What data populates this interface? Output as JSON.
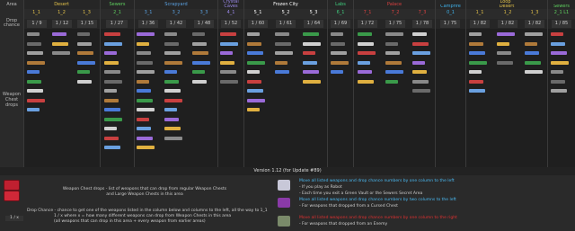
{
  "colors": {
    "desert": "#e3c24a",
    "sewers": "#5fd05f",
    "scrapyard": "#5aa0e0",
    "crystal": "#9a88e8",
    "frozen": "#ffffff",
    "labs": "#3fcf7f",
    "palace": "#d84040",
    "campfire": "#3fb0e8",
    "loop": "#e3c24a",
    "loopsewers": "#5fd05f"
  },
  "header": {
    "area_label": "Area",
    "zones": [
      {
        "name": "Desert",
        "color": "#e3c24a"
      },
      {
        "name": "Sewers",
        "color": "#5fd05f"
      },
      {
        "name": "Scrapyard",
        "color": "#5aa0e0"
      },
      {
        "name": "Crystal Caves",
        "color": "#9a88e8"
      },
      {
        "name": "Frozen City",
        "color": "#ffffff"
      },
      {
        "name": "Labs",
        "color": "#3fcf7f"
      },
      {
        "name": "Palace",
        "color": "#d84040"
      },
      {
        "name": "Loop",
        "color": "#e3c24a"
      }
    ],
    "loop_sub": [
      {
        "name": "Campfire",
        "color": "#3fb0e8"
      },
      {
        "name": "Desert",
        "color": "#e3c24a"
      },
      {
        "name": "Sewers",
        "color": "#5fd05f"
      }
    ],
    "levels": [
      "1_1",
      "1_2",
      "1_3",
      "2_1",
      "3_1",
      "3_2",
      "3_3",
      "4_1",
      "5_1",
      "5_2",
      "5_3",
      "6_1",
      "7_1",
      "7_2",
      "7_3",
      "0_1",
      "1_1",
      "1_2",
      "1_3",
      "2_1 L1"
    ]
  },
  "drop_chance": {
    "label": "Drop chance",
    "values": [
      "1 / 9",
      "1 / 12",
      "1 / 15",
      "1 / 27",
      "1 / 36",
      "1 / 42",
      "1 / 48",
      "1 / 52",
      "1 / 60",
      "1 / 61",
      "1 / 64",
      "1 / 69",
      "1 / 72",
      "1 / 75",
      "1 / 78",
      "1 / 75",
      "1 / 82",
      "1 / 82",
      "1 / 82",
      "1 / 85"
    ]
  },
  "weapon_chest_label": "Weapon Chest drops",
  "footer": {
    "version": "Version 1.12 (for Update #89)",
    "chest_line1": "Weapon Chest drops - list of weapons that can drop from regular Weapon Chests",
    "chest_line2": "and Large Weapon Chests in this area",
    "drop_line1": "Drop Chance - chance to get one of the weapons listed in the column below and columns to the left, all the way to 1_1",
    "drop_line2": "1 / x where x = how many different weapons can drop from Weapon Chests in this area",
    "drop_line3": "(all weapons that can drop in this area + every weapon from earlier areas)",
    "fraction": "1 / x",
    "robot_title": "Move all listed weapons and drop chance numbers by one column to the left",
    "robot_sub1": "- If you play as Robot",
    "robot_sub2": "- Each time you exit a Green Vault or the Sewers Secret Area",
    "cursed_title": "Move all listed weapons and drop chance numbers by two columns to the left",
    "cursed_sub": "- For weapons that dropped from a Cursed Chest",
    "enemy_title": "Move all listed weapons and drop chance numbers by one column to the right",
    "enemy_sub": "- For weapons that dropped from an Enemy"
  }
}
